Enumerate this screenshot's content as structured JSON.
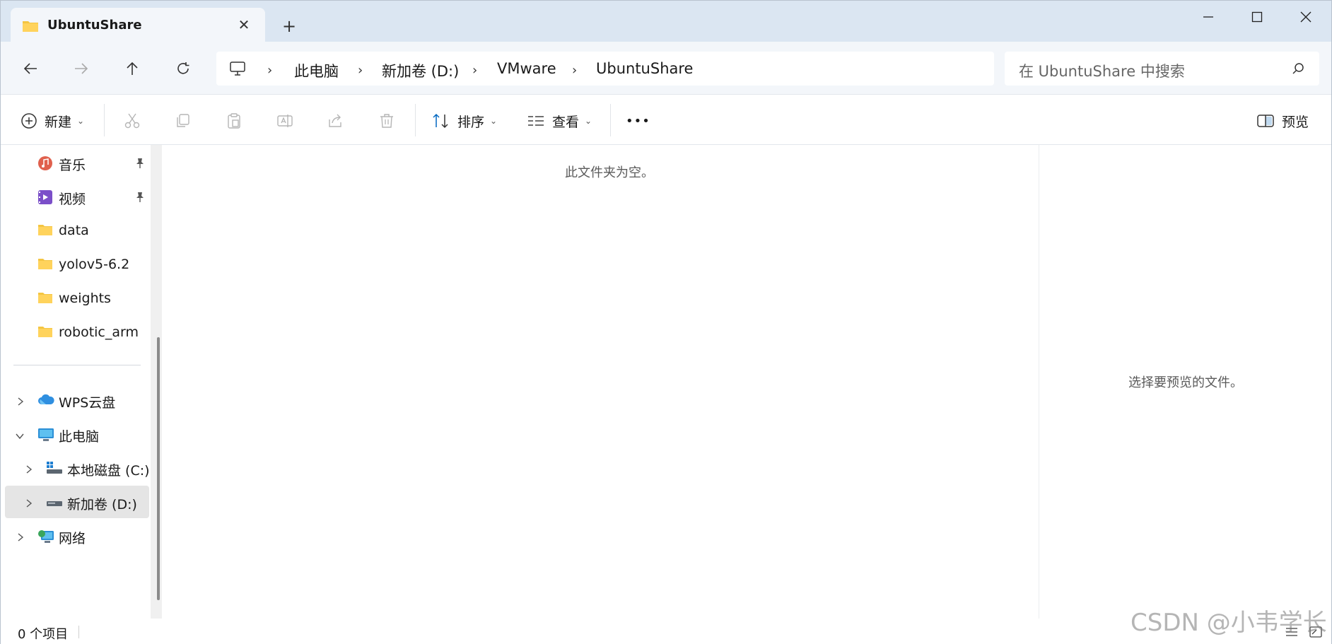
{
  "tab": {
    "title": "UbuntuShare",
    "new_tab": "+"
  },
  "breadcrumb": [
    "此电脑",
    "新加卷 (D:)",
    "VMware",
    "UbuntuShare"
  ],
  "search": {
    "placeholder": "在 UbuntuShare 中搜索"
  },
  "toolbar": {
    "new_label": "新建",
    "sort_label": "排序",
    "view_label": "查看",
    "more_label": "•••",
    "preview_label": "预览"
  },
  "sidebar": {
    "pinned": [
      {
        "label": "音乐",
        "icon": "music-icon",
        "pinned": true
      },
      {
        "label": "视频",
        "icon": "video-icon",
        "pinned": true
      },
      {
        "label": "data",
        "icon": "folder-icon"
      },
      {
        "label": "yolov5-6.2",
        "icon": "folder-icon"
      },
      {
        "label": "weights",
        "icon": "folder-icon"
      },
      {
        "label": "robotic_arm",
        "icon": "folder-icon"
      }
    ],
    "tree": [
      {
        "label": "WPS云盘",
        "icon": "cloud-icon",
        "expanded": false
      },
      {
        "label": "此电脑",
        "icon": "computer-icon",
        "expanded": true
      },
      {
        "label": "本地磁盘 (C:)",
        "icon": "drive-icon",
        "expanded": false
      },
      {
        "label": "新加卷 (D:)",
        "icon": "drive-icon",
        "expanded": false,
        "selected": true
      },
      {
        "label": "网络",
        "icon": "network-icon",
        "expanded": false
      }
    ]
  },
  "content": {
    "empty_message": "此文件夹为空。"
  },
  "preview": {
    "message": "选择要预览的文件。"
  },
  "status": {
    "item_count": "0 个项目"
  },
  "watermark": "CSDN @小韦学长",
  "colors": {
    "titlebar": "#dbe6f2",
    "addrbar": "#f3f6fa",
    "selected": "#e5e5e5",
    "folder": "#f4c542",
    "accent": "#0067c0"
  }
}
